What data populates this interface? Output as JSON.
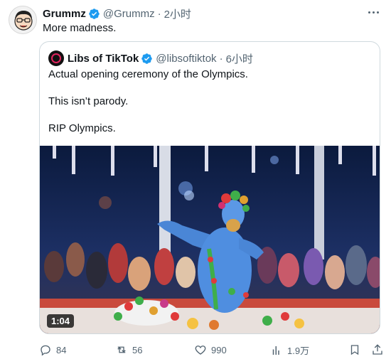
{
  "post": {
    "author_name": "Grummz",
    "author_handle": "@Grummz",
    "separator": "·",
    "time": "2小时",
    "text": "More madness.",
    "verified": true
  },
  "quote": {
    "author_name": "Libs of TikTok",
    "author_handle": "@libsoftiktok",
    "separator": "·",
    "time": "6小时",
    "lines": [
      "Actual opening ceremony of the Olympics.",
      "This isn’t parody.",
      "RIP Olympics."
    ],
    "verified": true,
    "video": {
      "duration": "1:04"
    }
  },
  "actions": {
    "replies": "84",
    "reposts": "56",
    "likes": "990",
    "views": "1.9万"
  },
  "icons": {
    "more": "more-icon",
    "verified": "verified-badge-icon",
    "reply": "reply-icon",
    "repost": "repost-icon",
    "like": "heart-icon",
    "views": "views-icon",
    "bookmark": "bookmark-icon",
    "share": "share-icon"
  },
  "colors": {
    "verified": "#1d9bf0",
    "secondary_text": "#536471",
    "border": "#cfd9de"
  }
}
